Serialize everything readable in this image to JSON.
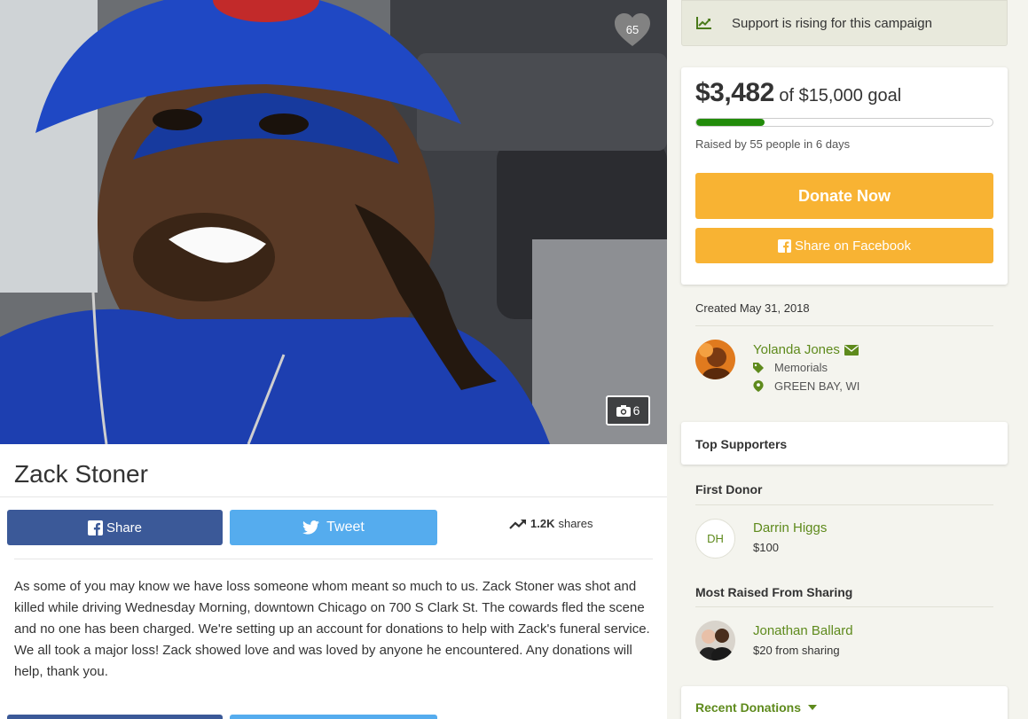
{
  "campaign": {
    "title": "Zack Stoner",
    "likes": "65",
    "photo_count": "6",
    "story": "As some of you may know we have loss someone whom meant so much to us. Zack Stoner was shot and killed while driving Wednesday Morning, downtown Chicago on 700 S Clark St. The cowards fled the scene and no one has been charged. We're setting up an account for donations to help with Zack's funeral service. We all took a major loss! Zack showed love and was loved by anyone he encountered. Any donations will help, thank you."
  },
  "share": {
    "facebook_label": "Share",
    "twitter_label": "Tweet",
    "count": "1.2K",
    "count_suffix": "shares"
  },
  "rising": {
    "text": "Support is rising for this campaign"
  },
  "goal": {
    "raised": "$3,482",
    "of_text": "of $15,000 goal",
    "progress_fraction": 0.232,
    "raised_by": "Raised by 55 people in 6 days",
    "donate_label": "Donate Now",
    "facebook_share_label": "Share on Facebook"
  },
  "organizer": {
    "created": "Created May 31, 2018",
    "name": "Yolanda Jones",
    "category": "Memorials",
    "location": "GREEN BAY, WI"
  },
  "supporters": {
    "title": "Top Supporters",
    "first_donor_title": "First Donor",
    "first_donor_initials": "DH",
    "first_donor_name": "Darrin Higgs",
    "first_donor_amount": "$100",
    "most_sharing_title": "Most Raised From Sharing",
    "most_sharing_name": "Jonathan Ballard",
    "most_sharing_amount": "$20 from sharing"
  },
  "recent": {
    "title": "Recent Donations"
  },
  "colors": {
    "facebook": "#3b5998",
    "twitter": "#55acee",
    "donate": "#f8b333",
    "progress": "#228b0a",
    "link_green": "#5e8a1c"
  }
}
